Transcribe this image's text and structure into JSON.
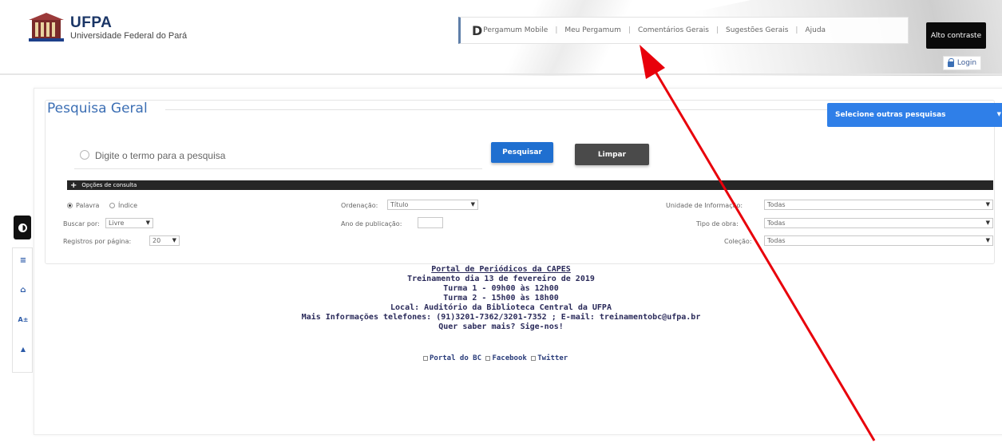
{
  "header": {
    "brand_name": "UFPA",
    "brand_sub": "Universidade Federal do Pará",
    "nav": {
      "d_glyph": "D",
      "items": [
        {
          "label": "Pergamum Mobile"
        },
        {
          "label": "Meu Pergamum"
        },
        {
          "label": "Comentários Gerais"
        },
        {
          "label": "Sugestões Gerais"
        },
        {
          "label": "Ajuda"
        }
      ]
    },
    "altocontraste_label": "Alto contraste",
    "login_label": "Login"
  },
  "accessibility": {
    "contrast_icon": "contrast-icon",
    "tools": [
      {
        "icon": "menu-icon",
        "glyph": "≡"
      },
      {
        "icon": "home-icon",
        "glyph": "⌂"
      },
      {
        "icon": "font-size-icon",
        "glyph": "A±"
      },
      {
        "icon": "scroll-top-icon",
        "glyph": "▲"
      }
    ]
  },
  "search": {
    "title": "Pesquisa Geral",
    "more_button": "Selecione outras pesquisas",
    "more_caret": "▼",
    "input_placeholder": "Digite o termo para a pesquisa",
    "submit_label": "Pesquisar",
    "clear_label": "Limpar",
    "options": {
      "header_label": "Opções de consulta",
      "radio_palavra": "Palavra",
      "radio_indice": "Índice",
      "buscar_por_label": "Buscar por:",
      "buscar_por_value": "Livre",
      "registros_label": "Registros por página:",
      "registros_value": "20",
      "ordenacao_label": "Ordenação:",
      "ordenacao_value": "Título",
      "ano_label": "Ano de publicação:",
      "unidade_label": "Unidade de Informação:",
      "unidade_value": "Todas",
      "tipo_label": "Tipo de obra:",
      "tipo_value": "Todas",
      "colecao_label": "Coleção:",
      "colecao_value": "Todas"
    }
  },
  "notice": {
    "title_link": "Portal de Periódicos da CAPES",
    "line1": "Treinamento dia 13 de fevereiro de 2019",
    "line2": "Turma 1 - 09h00 às 12h00",
    "line3": "Turma 2 - 15h00 às 18h00",
    "line4": "Local: Auditório da Biblioteca Central da UFPA",
    "line5": "Mais Informações telefones: (91)3201-7362/3201-7352 ; E-mail: treinamentobc@ufpa.br",
    "line6": "Quer saber mais? Sige-nos!",
    "link_portal": "Portal do BC",
    "link_facebook": "Facebook",
    "link_twitter": "Twitter"
  },
  "colors": {
    "brand_blue": "#3c6fb4",
    "primary_button": "#1f6fd0",
    "secondary_button": "#4a4a4a",
    "annotation_arrow": "#e8000b"
  }
}
